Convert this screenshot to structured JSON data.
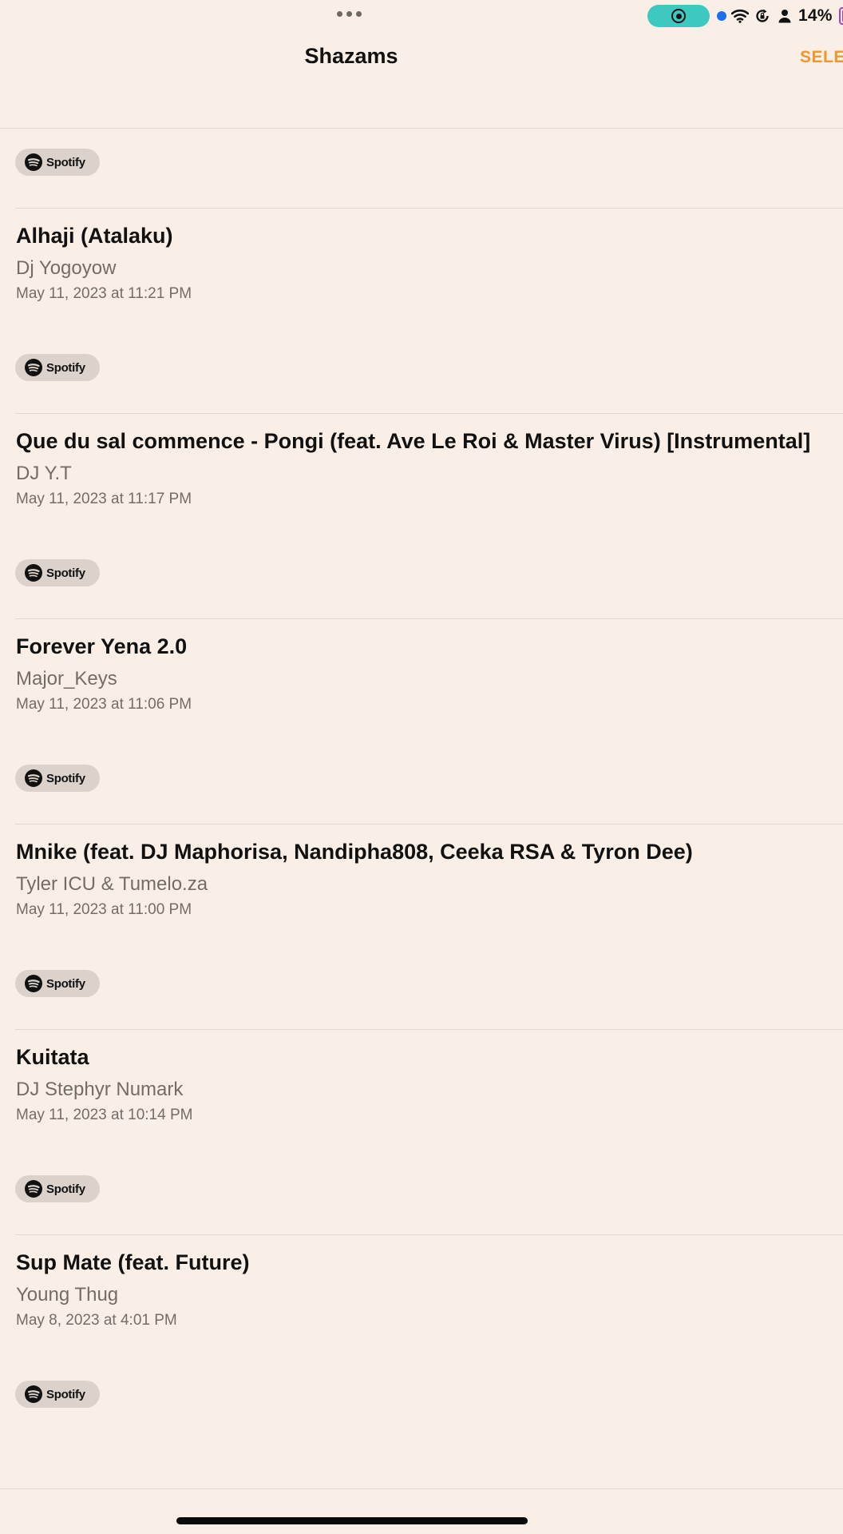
{
  "status_bar": {
    "battery_percent": "14%",
    "record_color": "#3ec9c0",
    "icons": [
      "more-dots-icon",
      "screen-record-icon",
      "location-dot-icon",
      "wifi-icon",
      "rotation-lock-icon",
      "person-icon",
      "battery-icon"
    ]
  },
  "nav": {
    "title": "Shazams",
    "select_label": "SELE"
  },
  "colors": {
    "background": "#faefe6",
    "accent": "#f0962a",
    "pill": "#dbd2cb"
  },
  "top_partial_item": {
    "spotify_label": "Spotify"
  },
  "songs": [
    {
      "title": "Alhaji (Atalaku)",
      "artist": "Dj Yogoyow",
      "date": "May 11, 2023 at 11:21 PM",
      "spotify_label": "Spotify"
    },
    {
      "title": "Que du sal commence - Pongi (feat. Ave Le Roi & Master Virus) [Instrumental]",
      "artist": "DJ Y.T",
      "date": "May 11, 2023 at 11:17 PM",
      "spotify_label": "Spotify"
    },
    {
      "title": "Forever Yena 2.0",
      "artist": "Major_Keys",
      "date": "May 11, 2023 at 11:06 PM",
      "spotify_label": "Spotify"
    },
    {
      "title": "Mnike (feat. DJ Maphorisa, Nandipha808, Ceeka RSA & Tyron Dee)",
      "artist": "Tyler ICU & Tumelo.za",
      "date": "May 11, 2023 at 11:00 PM",
      "spotify_label": "Spotify"
    },
    {
      "title": "Kuitata",
      "artist": "DJ Stephyr Numark",
      "date": "May 11, 2023 at 10:14 PM",
      "spotify_label": "Spotify"
    },
    {
      "title": "Sup Mate (feat. Future)",
      "artist": "Young Thug",
      "date": "May 8, 2023 at 4:01 PM",
      "spotify_label": "Spotify"
    }
  ]
}
